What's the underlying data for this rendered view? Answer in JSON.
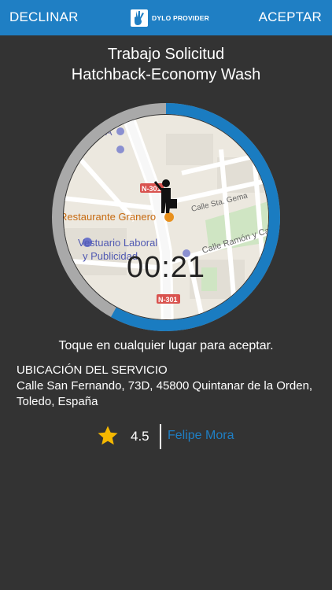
{
  "topbar": {
    "decline_label": "DECLINAR",
    "accept_label": "ACEPTAR",
    "logo_text": "DYLO PROVIDER",
    "background": "#1f7fc4"
  },
  "title": {
    "line1": "Trabajo Solicitud",
    "line2": "Hatchback-Economy Wash"
  },
  "map": {
    "labels": {
      "road_top": "N-301",
      "road_bottom": "N-301",
      "restaurant": "Restaurante Granero",
      "store_line1": "Vestuario Laboral",
      "store_line2": "y Publicidad",
      "street1": "Calle Sta. Gema",
      "street2": "Calle Ramón y Ca",
      "poi_top": "T S A"
    },
    "ring_color": "#1a7cc1",
    "timer_progress": 0.58
  },
  "timer": {
    "value": "00:21"
  },
  "hint": "Toque en cualquier lugar para aceptar.",
  "location": {
    "label": "UBICACIÓN DEL SERVICIO",
    "address": "Calle San Fernando, 73D, 45800 Quintanar de la Orden, Toledo, España"
  },
  "provider": {
    "rating": "4.5",
    "name": "Felipe Mora",
    "star_color": "#f5b800"
  }
}
